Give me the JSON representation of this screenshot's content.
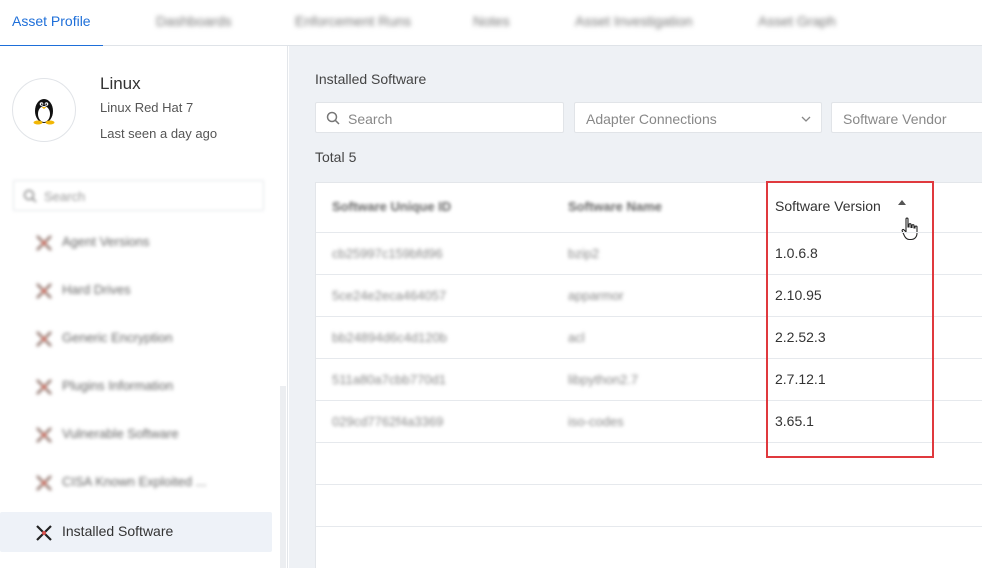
{
  "tabs": [
    {
      "label": "Asset Profile",
      "active": true
    },
    {
      "label": "Dashboards",
      "active": false
    },
    {
      "label": "Enforcement Runs",
      "active": false
    },
    {
      "label": "Notes",
      "active": false
    },
    {
      "label": "Asset Investigation",
      "active": false
    },
    {
      "label": "Asset Graph",
      "active": false
    }
  ],
  "asset": {
    "name": "Linux",
    "os": "Linux Red Hat 7",
    "last_seen": "Last seen a day ago",
    "icon": "tux-penguin-icon"
  },
  "sidebar": {
    "search_placeholder": "Search",
    "items": [
      {
        "label": "Agent Versions"
      },
      {
        "label": "Hard Drives"
      },
      {
        "label": "Generic Encryption"
      },
      {
        "label": "Plugins Information"
      },
      {
        "label": "Vulnerable Software"
      },
      {
        "label": "CISA Known Exploited ..."
      },
      {
        "label": "Installed Software",
        "active": true
      }
    ]
  },
  "main": {
    "section_title": "Installed Software",
    "search_placeholder": "Search",
    "adapter_filter": "Adapter Connections",
    "vendor_filter": "Software Vendor",
    "total_label": "Total",
    "total_count": "5",
    "columns": {
      "id": "Software Unique ID",
      "name": "Software Name",
      "version": "Software Version"
    },
    "rows": [
      {
        "id": "cb25997c159bfd96",
        "name": "bzip2",
        "version": "1.0.6.8"
      },
      {
        "id": "5ce24e2eca464057",
        "name": "apparmor",
        "version": "2.10.95"
      },
      {
        "id": "bb24894d6c4d120b",
        "name": "acl",
        "version": "2.2.52.3"
      },
      {
        "id": "511a80a7cbb770d1",
        "name": "libpython2.7",
        "version": "2.7.12.1"
      },
      {
        "id": "029cd7762f4a3369",
        "name": "iso-codes",
        "version": "3.65.1"
      }
    ]
  },
  "colors": {
    "accent": "#1e6fd9",
    "highlight": "#e0393e"
  }
}
